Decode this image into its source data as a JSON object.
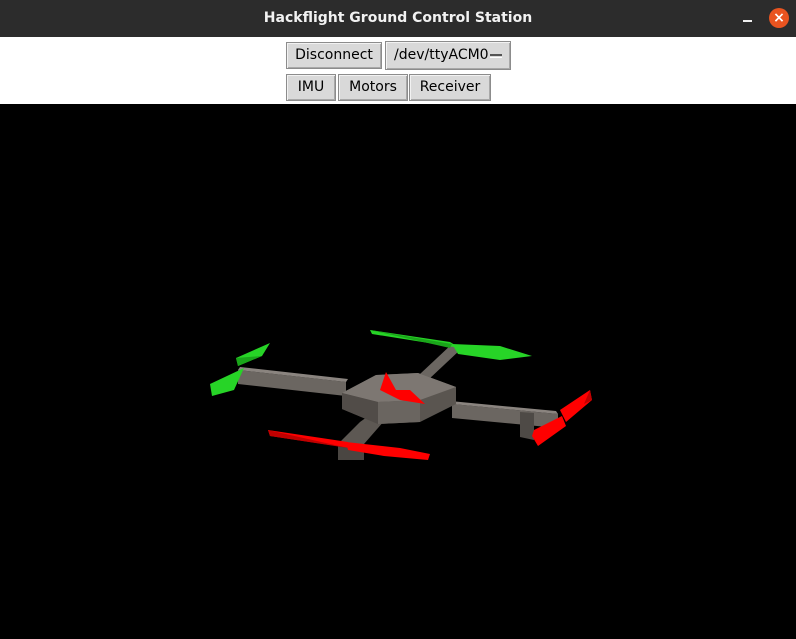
{
  "window": {
    "title": "Hackflight Ground Control Station"
  },
  "toolbar": {
    "disconnect_label": "Disconnect",
    "port_value": "/dev/ttyACM0",
    "tabs": [
      {
        "label": "IMU"
      },
      {
        "label": "Motors"
      },
      {
        "label": "Receiver"
      }
    ]
  },
  "viewport": {
    "model": "quadcopter",
    "colors": {
      "front_propellers": "#ff0000",
      "rear_propellers": "#22dd22",
      "frame": "#5d5853",
      "heading_arrow": "#ff0000",
      "background": "#000000"
    }
  }
}
